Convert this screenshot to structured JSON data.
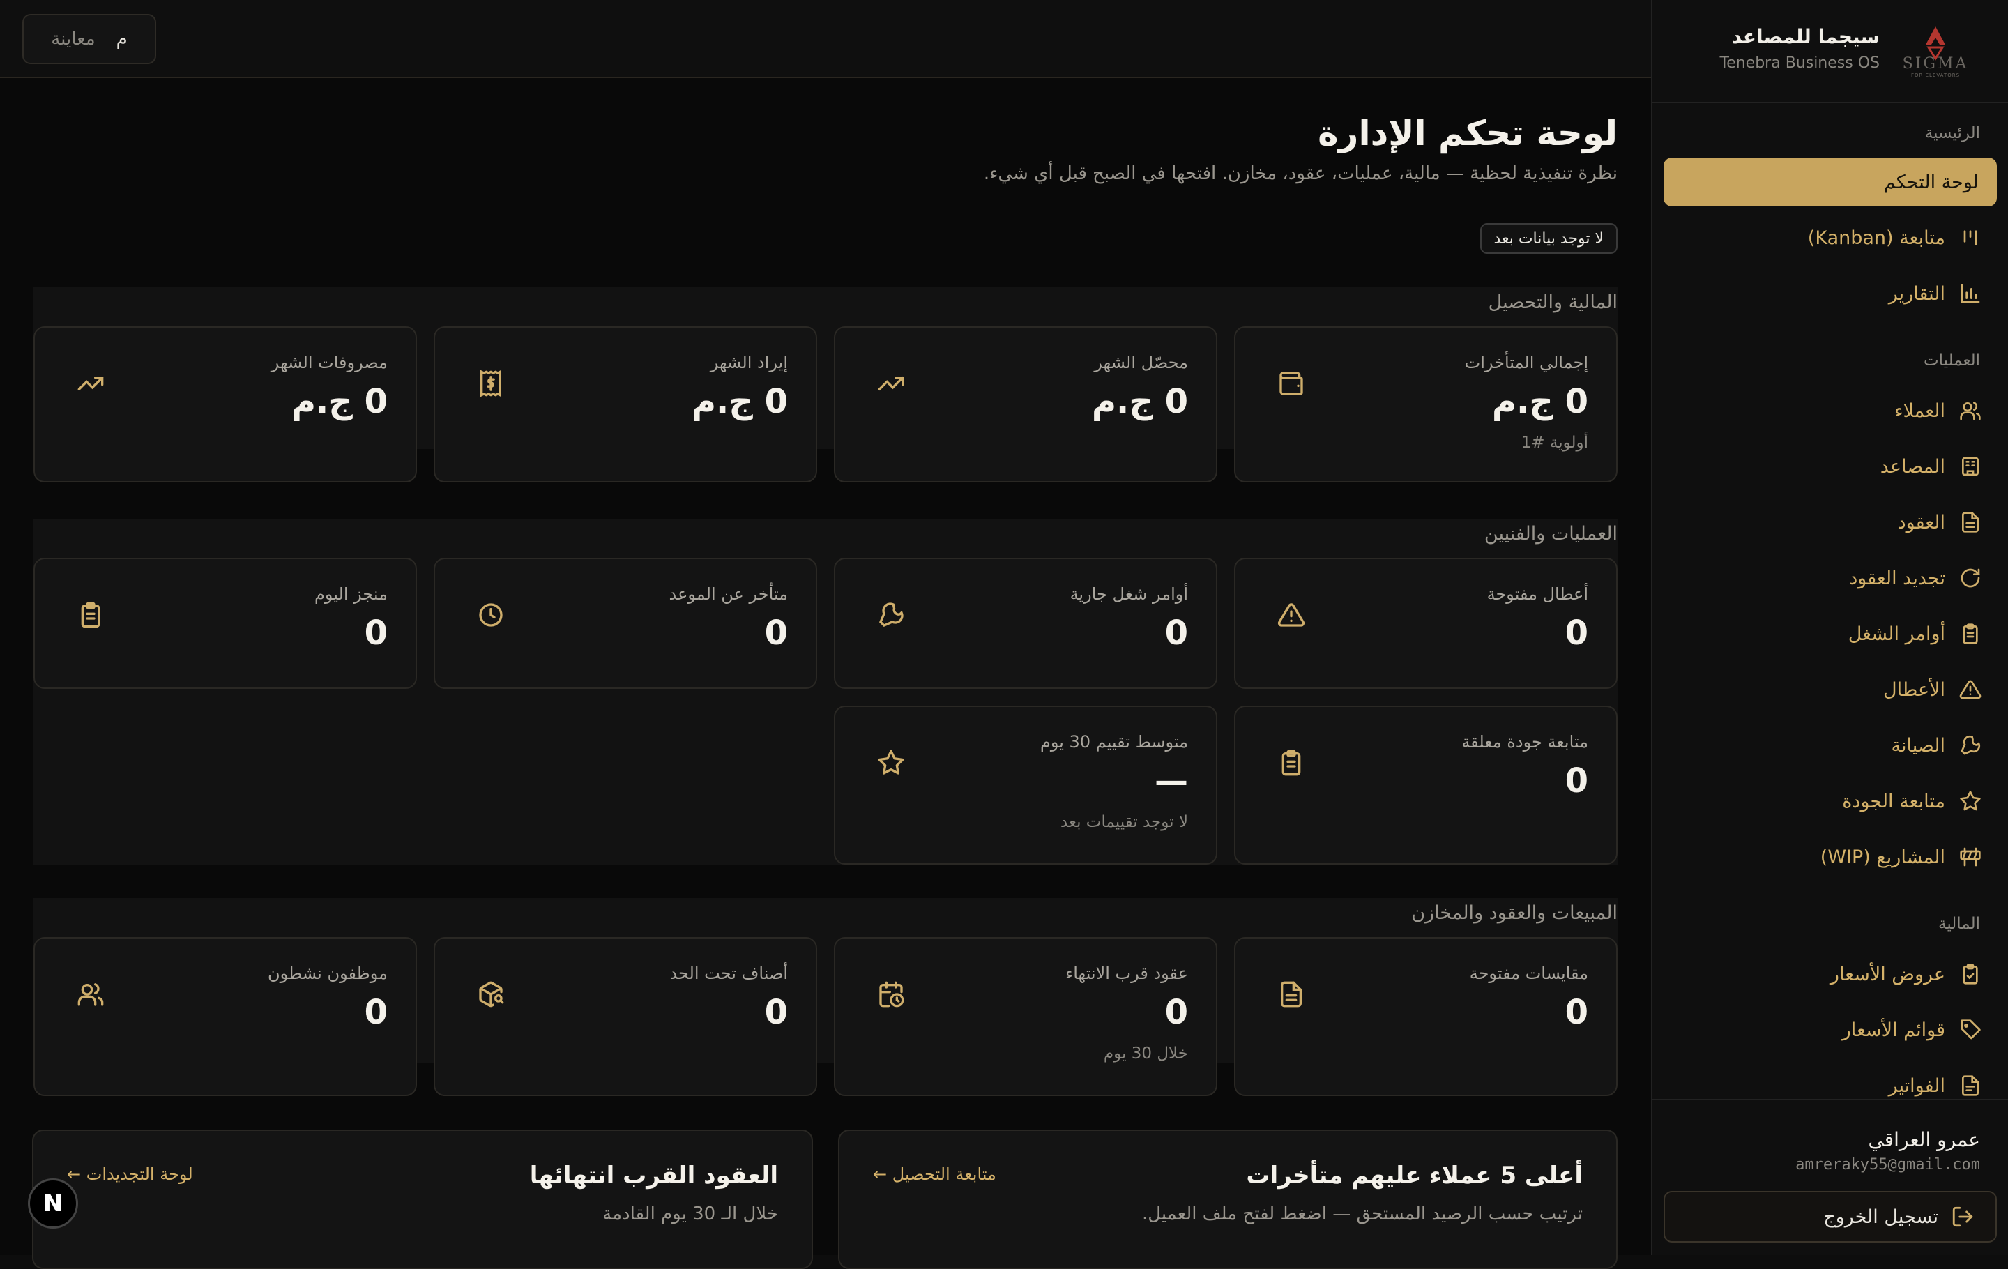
{
  "brand": {
    "name": "سيجما للمصاعد",
    "subtitle": "Tenebra Business OS",
    "logo_text": "SIGMA",
    "logo_tagline": "FOR ELEVATORS",
    "accent": "#c8a55e"
  },
  "topbar": {
    "preview_label": "معاينة",
    "preview_key": "م"
  },
  "sidebar": {
    "sections": [
      "الرئيسية",
      "العمليات",
      "المالية"
    ],
    "items": [
      {
        "label": "لوحة التحكم",
        "icon": "dashboard-icon",
        "active": true
      },
      {
        "label": "متابعة (Kanban)",
        "icon": "kanban-icon"
      },
      {
        "label": "التقارير",
        "icon": "bar-chart-icon"
      },
      {
        "label": "العملاء",
        "icon": "users-icon"
      },
      {
        "label": "المصاعد",
        "icon": "building-icon"
      },
      {
        "label": "العقود",
        "icon": "document-icon"
      },
      {
        "label": "تجديد العقود",
        "icon": "refresh-icon"
      },
      {
        "label": "أوامر الشغل",
        "icon": "clipboard-icon"
      },
      {
        "label": "الأعطال",
        "icon": "alert-triangle-icon"
      },
      {
        "label": "الصيانة",
        "icon": "wrench-icon"
      },
      {
        "label": "متابعة الجودة",
        "icon": "star-icon"
      },
      {
        "label": "المشاريع (WIP)",
        "icon": "barrier-icon"
      },
      {
        "label": "عروض الأسعار",
        "icon": "clipboard-check-icon"
      },
      {
        "label": "قوائم الأسعار",
        "icon": "tag-icon"
      },
      {
        "label": "الفواتير",
        "icon": "invoice-icon"
      }
    ]
  },
  "user": {
    "name": "عمرو العراقي",
    "email": "amreraky55@gmail.com",
    "logout_label": "تسجيل الخروج"
  },
  "page": {
    "title": "لوحة تحكم الإدارة",
    "subtitle": "نظرة تنفيذية لحظية — مالية، عمليات، عقود، مخازن. افتحها في الصبح قبل أي شيء.",
    "status_badge": "لا توجد بيانات بعد"
  },
  "finance": {
    "title": "المالية والتحصيل",
    "cards": [
      {
        "label": "إجمالي المتأخرات",
        "value": "0 ج.م",
        "note": "أولوية #1",
        "icon": "wallet-icon"
      },
      {
        "label": "محصّل الشهر",
        "value": "0 ج.م",
        "icon": "trending-up-icon"
      },
      {
        "label": "إيراد الشهر",
        "value": "0 ج.م",
        "icon": "receipt-icon"
      },
      {
        "label": "مصروفات الشهر",
        "value": "0 ج.م",
        "icon": "trending-up-icon"
      }
    ]
  },
  "operations": {
    "title": "العمليات والفنيين",
    "cards": [
      {
        "label": "أعطال مفتوحة",
        "value": "0",
        "icon": "alert-triangle-icon"
      },
      {
        "label": "أوامر شغل جارية",
        "value": "0",
        "icon": "wrench-icon"
      },
      {
        "label": "متأخر عن الموعد",
        "value": "0",
        "icon": "clock-icon"
      },
      {
        "label": "منجز اليوم",
        "value": "0",
        "icon": "clipboard-icon"
      },
      {
        "label": "متابعة جودة معلقة",
        "value": "0",
        "icon": "clipboard-icon"
      },
      {
        "label": "متوسط تقييم 30 يوم",
        "value": "—",
        "note": "لا توجد تقييمات بعد",
        "icon": "star-icon"
      }
    ]
  },
  "sales": {
    "title": "المبيعات والعقود والمخازن",
    "cards": [
      {
        "label": "مقايسات مفتوحة",
        "value": "0",
        "icon": "document-icon"
      },
      {
        "label": "عقود قرب الانتهاء",
        "value": "0",
        "note": "خلال 30 يوم",
        "icon": "calendar-clock-icon"
      },
      {
        "label": "أصناف تحت الحد",
        "value": "0",
        "icon": "package-search-icon"
      },
      {
        "label": "موظفون نشطون",
        "value": "0",
        "icon": "users-icon"
      }
    ]
  },
  "panels": {
    "overdue": {
      "title": "أعلى 5 عملاء عليهم متأخرات",
      "subtitle": "ترتيب حسب الرصيد المستحق — اضغط لفتح ملف العميل.",
      "link": "متابعة التحصيل ←"
    },
    "expiring": {
      "title": "العقود القرب انتهائها",
      "subtitle": "خلال الـ 30 يوم القادمة",
      "link": "لوحة التجديدات ←"
    }
  },
  "dev_badge": "N"
}
